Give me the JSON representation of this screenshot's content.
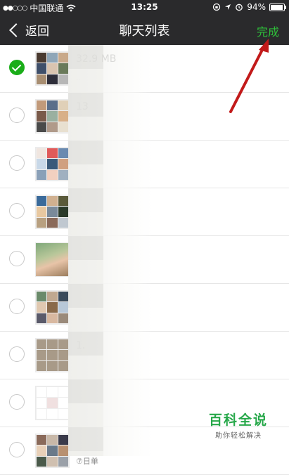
{
  "status_bar": {
    "signal_dots": "●●○○○",
    "carrier": "中国联通",
    "time": "13:25",
    "battery_percent": "94%",
    "battery_level": 0.94
  },
  "nav": {
    "back_label": "返回",
    "title": "聊天列表",
    "done_label": "完成"
  },
  "rows": [
    {
      "selected": true,
      "title": "32.9 MB",
      "subtitle": "..",
      "avatar": "grid",
      "colors": [
        "#4a3a30",
        "#8fa6b8",
        "#c9a98a",
        "#3f4f6a",
        "#d9c4b0",
        "#6a7a5a",
        "#a88e72",
        "#2e2e3a",
        "#b7b7b7"
      ]
    },
    {
      "selected": false,
      "title": "13",
      "subtitle": "",
      "avatar": "grid",
      "colors": [
        "#c29a7a",
        "#5a6e8a",
        "#e0d0b8",
        "#7a5a4a",
        "#9ab0a0",
        "#d8b088",
        "#4a4a4a",
        "#b09a8a",
        "#e8e0d0"
      ]
    },
    {
      "selected": false,
      "title": "",
      "subtitle": "",
      "avatar": "grid",
      "colors": [
        "#f0e6e0",
        "#e05a5a",
        "#6a8ab0",
        "#c8d8e8",
        "#3a5a7a",
        "#d0a080",
        "#8aa0b8",
        "#f2d0c0",
        "#a0b0c0"
      ]
    },
    {
      "selected": false,
      "title": "",
      "subtitle": "",
      "avatar": "grid",
      "colors": [
        "#3a6a9a",
        "#d0b090",
        "#5a5a3a",
        "#e8c8a0",
        "#7a8a9a",
        "#2a3a2a",
        "#b8a080",
        "#8a6a5a",
        "#c0c8d0"
      ]
    },
    {
      "selected": false,
      "title": "",
      "subtitle": "",
      "avatar": "photo",
      "colors": []
    },
    {
      "selected": false,
      "title": "",
      "subtitle": "",
      "avatar": "grid",
      "colors": [
        "#6a8a6a",
        "#c0a890",
        "#3a4a5a",
        "#e0c8b0",
        "#8a6a4a",
        "#b8c8d8",
        "#5a5a6a",
        "#d8b8a0",
        "#9a8a7a"
      ]
    },
    {
      "selected": false,
      "title": "1.",
      "subtitle": "",
      "avatar": "grid",
      "colors": [
        "#a89a88",
        "#a89a88",
        "#a89a88",
        "#a89a88",
        "#a89a88",
        "#a89a88",
        "#a89a88",
        "#a89a88",
        "#a89a88"
      ]
    },
    {
      "selected": false,
      "title": "",
      "subtitle": "",
      "avatar": "grid",
      "colors": [
        "#ffffff",
        "#ffffff",
        "#ffffff",
        "#ffffff",
        "#f0e0e0",
        "#ffffff",
        "#ffffff",
        "#ffffff",
        "#ffffff"
      ]
    },
    {
      "selected": false,
      "title": "",
      "subtitle": "⑦日单",
      "avatar": "grid",
      "colors": [
        "#8a6a5a",
        "#c8b8a8",
        "#3a3a4a",
        "#e8d0b8",
        "#6a7a8a",
        "#b89070",
        "#4a5a4a",
        "#d0c0b0",
        "#9aa0a8"
      ]
    }
  ],
  "watermark": {
    "main": "百科全说",
    "sub": "助你轻松解决"
  },
  "colors": {
    "bar_bg": "#2a2a2c",
    "accent_green": "#2fbe3a",
    "check_green": "#1aad19",
    "arrow_red": "#c21a1a"
  }
}
